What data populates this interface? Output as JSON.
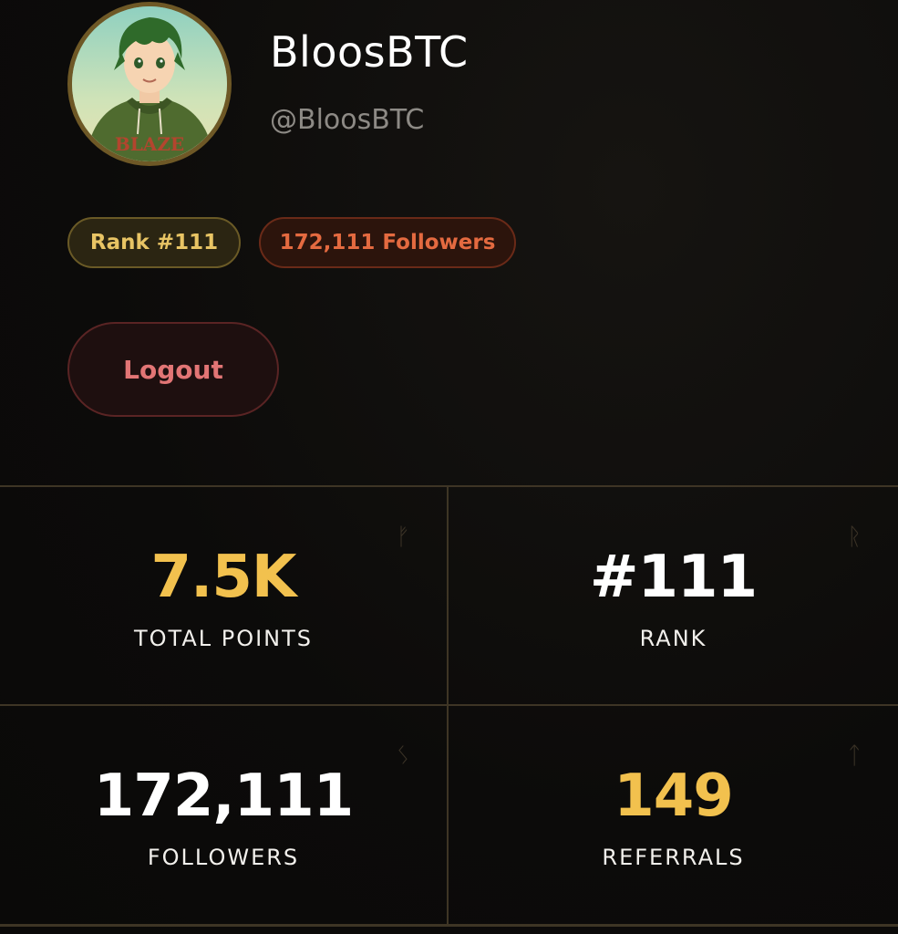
{
  "profile": {
    "display_name": "BloosBTC",
    "handle": "@BloosBTC",
    "avatar_text": "BLAZE"
  },
  "badges": {
    "rank": "Rank #111",
    "followers": "172,111 Followers"
  },
  "actions": {
    "logout_label": "Logout"
  },
  "stats": [
    {
      "value": "7.5K",
      "label": "TOTAL POINTS",
      "glyph": "ᚠ",
      "color": "#f2c14e"
    },
    {
      "value": "#111",
      "label": "RANK",
      "glyph": "ᚱ",
      "color": "#ffffff"
    },
    {
      "value": "172,111",
      "label": "FOLLOWERS",
      "glyph": "ᛊ",
      "color": "#ffffff"
    },
    {
      "value": "149",
      "label": "REFERRALS",
      "glyph": "ᛏ",
      "color": "#f2c14e"
    }
  ],
  "colors": {
    "accent_gold": "#f2c14e",
    "badge_rank_text": "#e8c464",
    "badge_followers_text": "#e46a40",
    "logout_text": "#e27575",
    "background": "#0d0c0b"
  }
}
